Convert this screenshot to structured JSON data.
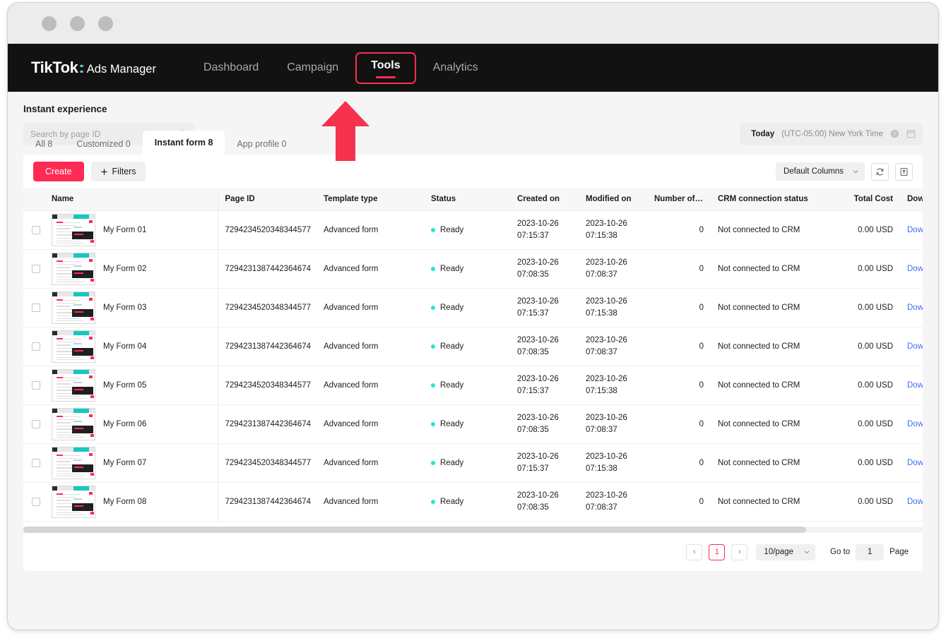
{
  "browser": {
    "dots": [
      "close",
      "minimize",
      "maximize"
    ]
  },
  "nav": {
    "brand_main": "TikTok",
    "brand_colon": ":",
    "brand_sub": "Ads Manager",
    "links": [
      {
        "label": "Dashboard",
        "active": false
      },
      {
        "label": "Campaign",
        "active": false
      },
      {
        "label": "Tools",
        "active": true
      },
      {
        "label": "Analytics",
        "active": false
      }
    ]
  },
  "page": {
    "title": "Instant experience"
  },
  "search": {
    "placeholder": "Search by page ID",
    "value": ""
  },
  "daterange": {
    "today_label": "Today",
    "timezone": "(UTC-05:00) New York Time"
  },
  "tabs": [
    {
      "label": "All 8",
      "active": false
    },
    {
      "label": "Customized 0",
      "active": false
    },
    {
      "label": "Instant form 8",
      "active": true
    },
    {
      "label": "App profile 0",
      "active": false
    }
  ],
  "toolbar": {
    "create_label": "Create",
    "filters_label": "Filters",
    "columns_label": "Default Columns"
  },
  "table": {
    "headers": [
      "Name",
      "Page ID",
      "Template type",
      "Status",
      "Created on",
      "Modified on",
      "Number of rel...",
      "CRM connection status",
      "Total Cost",
      "Download Leac"
    ],
    "rows": [
      {
        "name": "My Form 01",
        "page_id": "7294234520348344577",
        "template": "Advanced form",
        "status": "Ready",
        "created_date": "2023-10-26",
        "created_time": "07:15:37",
        "modified_date": "2023-10-26",
        "modified_time": "07:15:38",
        "num_related": "0",
        "crm": "Not connected to CRM",
        "cost": "0.00 USD",
        "download": "Download Lead Dat"
      },
      {
        "name": "My Form 02",
        "page_id": "7294231387442364674",
        "template": "Advanced form",
        "status": "Ready",
        "created_date": "2023-10-26",
        "created_time": "07:08:35",
        "modified_date": "2023-10-26",
        "modified_time": "07:08:37",
        "num_related": "0",
        "crm": "Not connected to CRM",
        "cost": "0.00 USD",
        "download": "Download Lead Dat"
      },
      {
        "name": "My Form 03",
        "page_id": "7294234520348344577",
        "template": "Advanced form",
        "status": "Ready",
        "created_date": "2023-10-26",
        "created_time": "07:15:37",
        "modified_date": "2023-10-26",
        "modified_time": "07:15:38",
        "num_related": "0",
        "crm": "Not connected to CRM",
        "cost": "0.00 USD",
        "download": "Download Lead Dat"
      },
      {
        "name": "My Form 04",
        "page_id": "7294231387442364674",
        "template": "Advanced form",
        "status": "Ready",
        "created_date": "2023-10-26",
        "created_time": "07:08:35",
        "modified_date": "2023-10-26",
        "modified_time": "07:08:37",
        "num_related": "0",
        "crm": "Not connected to CRM",
        "cost": "0.00 USD",
        "download": "Download Lead Dat"
      },
      {
        "name": "My Form 05",
        "page_id": "7294234520348344577",
        "template": "Advanced form",
        "status": "Ready",
        "created_date": "2023-10-26",
        "created_time": "07:15:37",
        "modified_date": "2023-10-26",
        "modified_time": "07:15:38",
        "num_related": "0",
        "crm": "Not connected to CRM",
        "cost": "0.00 USD",
        "download": "Download Lead Dat"
      },
      {
        "name": "My Form 06",
        "page_id": "7294231387442364674",
        "template": "Advanced form",
        "status": "Ready",
        "created_date": "2023-10-26",
        "created_time": "07:08:35",
        "modified_date": "2023-10-26",
        "modified_time": "07:08:37",
        "num_related": "0",
        "crm": "Not connected to CRM",
        "cost": "0.00 USD",
        "download": "Download Lead Dat"
      },
      {
        "name": "My Form 07",
        "page_id": "7294234520348344577",
        "template": "Advanced form",
        "status": "Ready",
        "created_date": "2023-10-26",
        "created_time": "07:15:37",
        "modified_date": "2023-10-26",
        "modified_time": "07:15:38",
        "num_related": "0",
        "crm": "Not connected to CRM",
        "cost": "0.00 USD",
        "download": "Download Lead Dat"
      },
      {
        "name": "My Form 08",
        "page_id": "7294231387442364674",
        "template": "Advanced form",
        "status": "Ready",
        "created_date": "2023-10-26",
        "created_time": "07:08:35",
        "modified_date": "2023-10-26",
        "modified_time": "07:08:37",
        "num_related": "0",
        "crm": "Not connected to CRM",
        "cost": "0.00 USD",
        "download": "Download Lead Dat"
      }
    ]
  },
  "pagination": {
    "prev": "‹",
    "next": "›",
    "current_page": "1",
    "page_size": "10/page",
    "goto_label": "Go to",
    "goto_value": "1",
    "page_label": "Page"
  },
  "annotation": {
    "type": "arrow-up",
    "points_to": "Tools",
    "color": "#f5334f"
  },
  "colors": {
    "brand_pink": "#fe2c55",
    "brand_cyan": "#25f4ee",
    "status_ready": "#25e5d2",
    "link_blue": "#3b6ef0",
    "nav_bg": "#121212"
  }
}
